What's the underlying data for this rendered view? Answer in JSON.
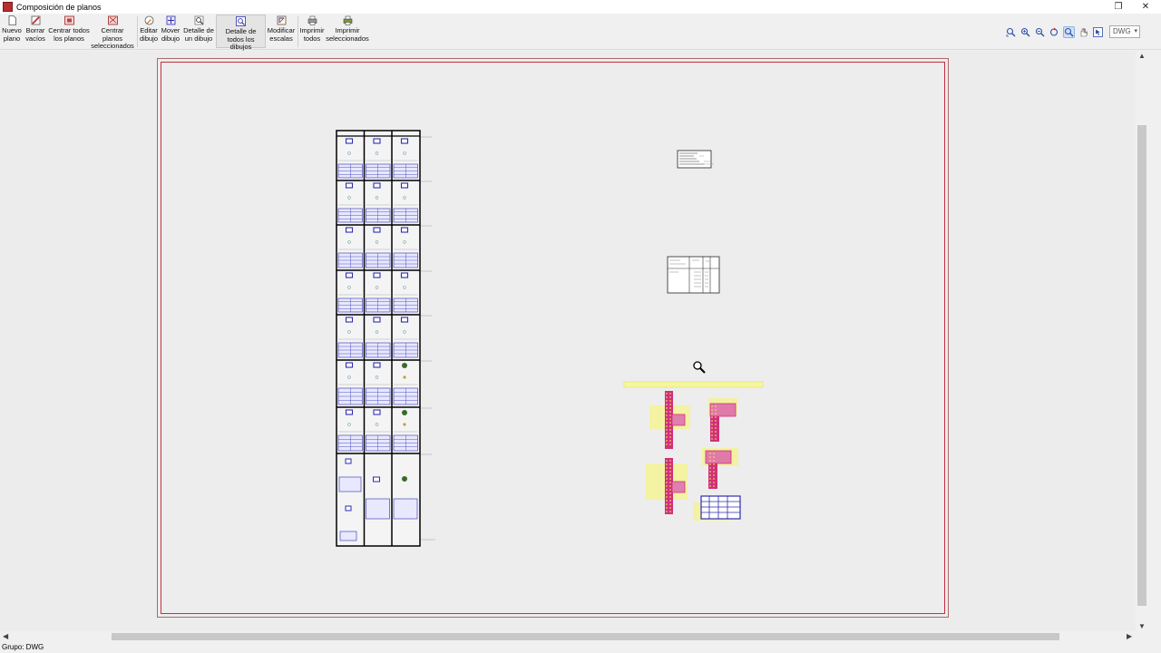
{
  "window": {
    "title": "Composición de planos"
  },
  "toolbar": {
    "new_plan": "Nuevo plano",
    "delete_empty": "Borrar vacíos",
    "center_all": "Centrar todos los planos",
    "center_selected": "Centrar planos seleccionados",
    "edit_drawing": "Editar dibujo",
    "move_drawing": "Mover dibujo",
    "detail_one": "Detalle de un dibujo",
    "detail_all": "Detalle de todos los dibujos",
    "modify_scales": "Modificar escalas",
    "print_all": "Imprimir todos",
    "print_selected": "Imprimir seleccionados"
  },
  "view": {
    "format": "DWG"
  },
  "status": {
    "group": "Grupo: DWG"
  },
  "icons": [
    "new-plan-icon",
    "delete-empty-icon",
    "center-all-icon",
    "center-selected-icon",
    "edit-drawing-icon",
    "move-drawing-icon",
    "detail-one-icon",
    "detail-all-icon",
    "modify-scales-icon",
    "print-all-icon",
    "print-selected-icon",
    "zoom-window-icon",
    "zoom-magnify-icon",
    "zoom-out-icon",
    "zoom-extents-icon",
    "zoom-in-icon",
    "pan-hand-icon",
    "select-icon",
    "magnifier-cursor-icon"
  ],
  "colors": {
    "sheet_border": "#c4313f",
    "accent_blue": "#2d2db0",
    "rebar_magenta": "#d0307a",
    "highlight_yellow": "#f2f27a"
  }
}
